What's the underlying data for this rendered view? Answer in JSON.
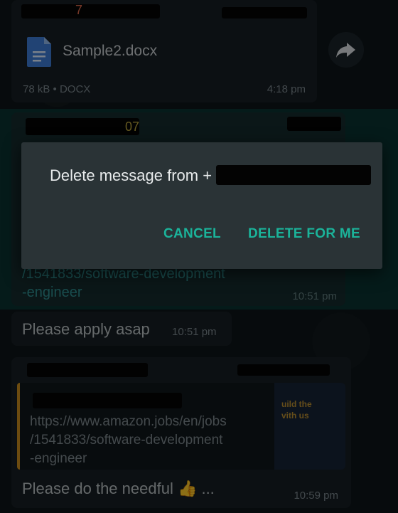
{
  "background_color": "#0d1418",
  "accent_color": "#1bb39a",
  "messages": {
    "doc": {
      "sender_visible": "7",
      "file_name": "Sample2.docx",
      "meta": "78 kB • DOCX",
      "time": "4:18 pm",
      "file_icon": "document-icon",
      "forward_icon": "forward-arrow-icon"
    },
    "selected": {
      "sender_visible": "07",
      "link_tail": "/1541833/software-development",
      "link_tail2": "-engineer",
      "time": "10:51 pm"
    },
    "apply": {
      "text": "Please apply asap",
      "time": "10:51 pm"
    },
    "link": {
      "preview_title_1": "uild the",
      "preview_title_2": "vith us",
      "url_1": "https://www.amazon.jobs/en/jobs",
      "url_2": "/1541833/software-development",
      "url_3": "-engineer",
      "body": "Please do the needful 👍 ...",
      "time": "10:59 pm"
    }
  },
  "dialog": {
    "message": "Delete message from +",
    "cancel_label": "CANCEL",
    "delete_label": "DELETE FOR ME"
  }
}
